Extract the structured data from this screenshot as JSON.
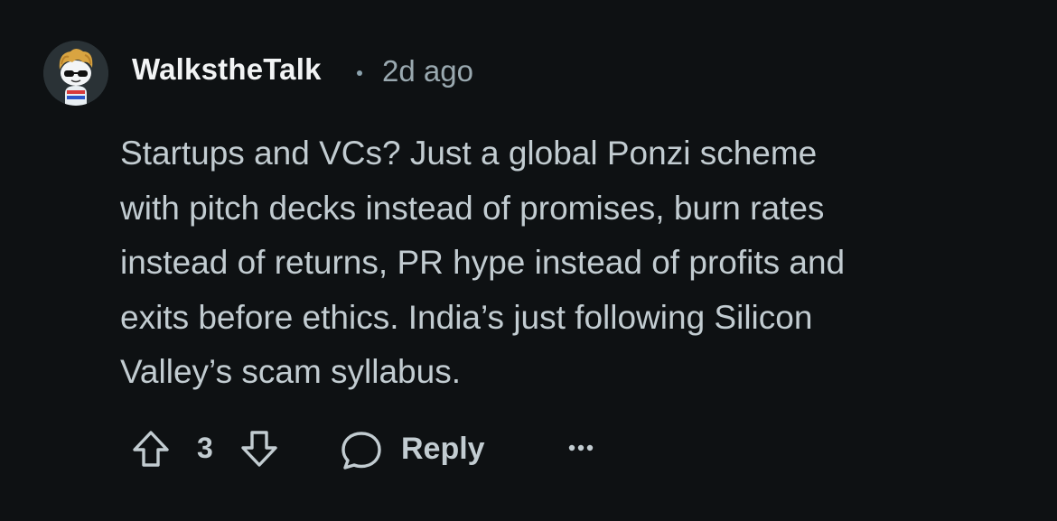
{
  "comment": {
    "author": "WalkstheTalk",
    "separator": "•",
    "timestamp": "2d ago",
    "body": "Startups and VCs? Just a global Ponzi scheme\nwith pitch decks instead of promises, burn rates\ninstead of returns, PR hype instead of profits and\nexits before ethics. India’s just following Silicon\nValley’s scam syllabus.",
    "score": "3",
    "reply_label": "Reply",
    "icons": {
      "avatar": "avatar-snoo-icon",
      "upvote": "upvote-arrow-icon",
      "downvote": "downvote-arrow-icon",
      "reply": "speech-bubble-icon",
      "more": "ellipsis-icon"
    }
  },
  "colors": {
    "background": "#0e1113",
    "text": "#c2ccd1",
    "username": "#f2f4f5",
    "muted": "#9aa9b0"
  }
}
